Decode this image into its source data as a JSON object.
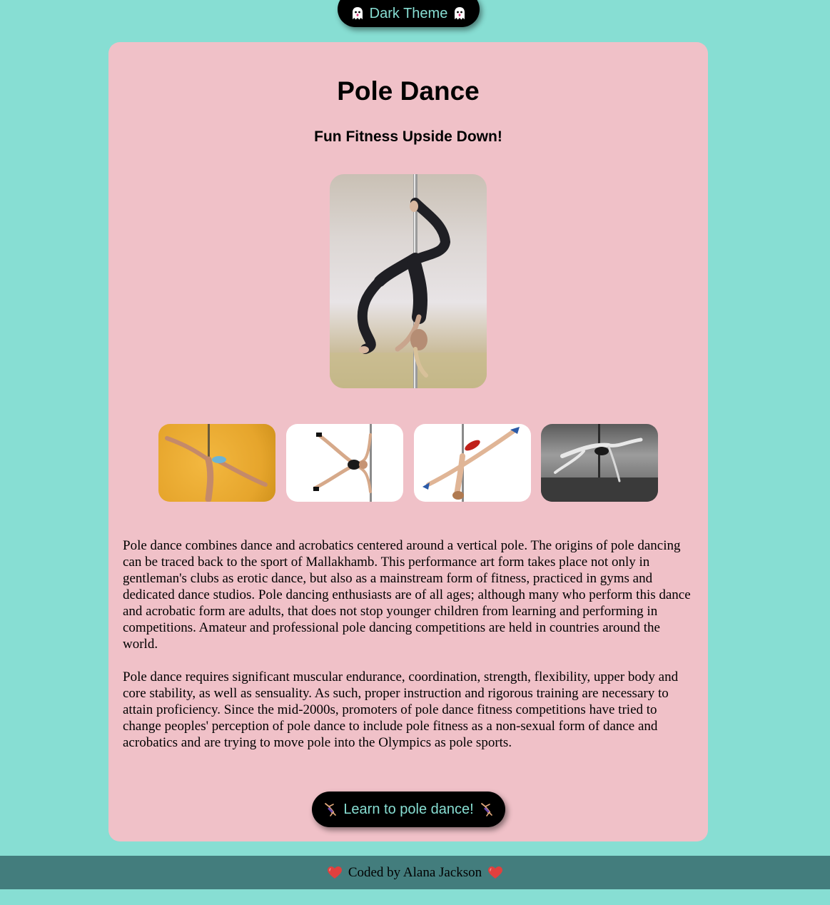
{
  "theme_toggle": {
    "label": "Dark Theme",
    "icon": "ghost-icon"
  },
  "card": {
    "title": "Pole Dance",
    "subtitle": "Fun Fitness Upside Down!",
    "hero_image": "pole-dancer-inverted-photo",
    "thumbnails": [
      "pole-dancer-yellow-background-photo",
      "pole-dancer-star-pose-photo",
      "pole-dancer-red-shorts-split-photo",
      "pole-dancer-black-and-white-photo"
    ],
    "paragraphs": [
      "Pole dance combines dance and acrobatics centered around a vertical pole. The origins of pole dancing can be traced back to the sport of Mallakhamb. This performance art form takes place not only in gentleman's clubs as erotic dance, but also as a mainstream form of fitness, practiced in gyms and dedicated dance studios. Pole dancing enthusiasts are of all ages; although many who perform this dance and acrobatic form are adults, that does not stop younger children from learning and performing in competitions. Amateur and professional pole dancing competitions are held in countries around the world.",
      "Pole dance requires significant muscular endurance, coordination, strength, flexibility, upper body and core stability, as well as sensuality. As such, proper instruction and rigorous training are necessary to attain proficiency. Since the mid-2000s, promoters of pole dance fitness competitions have tried to change peoples' perception of pole dance to include pole fitness as a non-sexual form of dance and acrobatics and are trying to move pole into the Olympics as pole sports."
    ],
    "cta": {
      "label": "Learn to pole dance!",
      "icon": "gymnast-icon"
    }
  },
  "footer": {
    "text": "Coded by Alana Jackson",
    "icon": "heart-icon"
  },
  "colors": {
    "page_background": "#87ded3",
    "card_background": "#f0c1c8",
    "button_background": "#000000",
    "button_text": "#87ded3",
    "footer_background": "#437d7d"
  }
}
